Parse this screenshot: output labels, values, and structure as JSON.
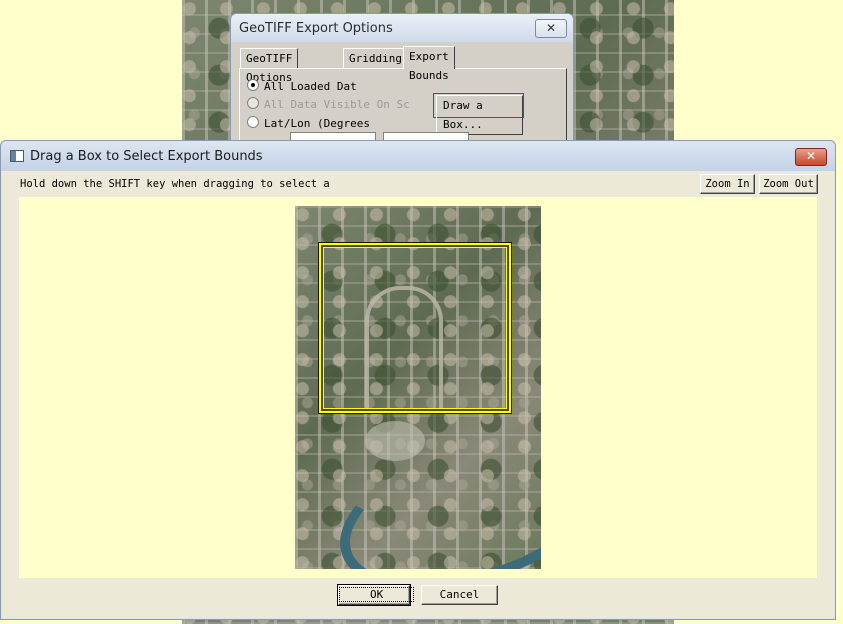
{
  "background_dialog": {
    "title": "GeoTIFF Export Options",
    "close_glyph": "✕",
    "tabs": [
      {
        "label": "GeoTIFF Options",
        "active": false
      },
      {
        "label": "Gridding",
        "active": false
      },
      {
        "label": "Export Bounds",
        "active": true
      }
    ],
    "options": [
      {
        "label": "All Loaded Dat",
        "selected": true,
        "enabled": true
      },
      {
        "label": "All Data Visible On Sc",
        "selected": false,
        "enabled": false
      },
      {
        "label": "Lat/Lon (Degrees",
        "selected": false,
        "enabled": true
      }
    ],
    "draw_box_label": "Draw a Box..."
  },
  "dialog": {
    "title": "Drag a Box to Select Export Bounds",
    "close_glyph": "✕",
    "hint": "Hold down the SHIFT key when dragging to select a",
    "zoom_in_label": "Zoom In",
    "zoom_out_label": "Zoom Out",
    "ok_label": "OK",
    "cancel_label": "Cancel"
  },
  "colors": {
    "selection_box": "#ffff00",
    "canvas_background": "#ffffcc",
    "highlight_border": "#e0181e"
  }
}
